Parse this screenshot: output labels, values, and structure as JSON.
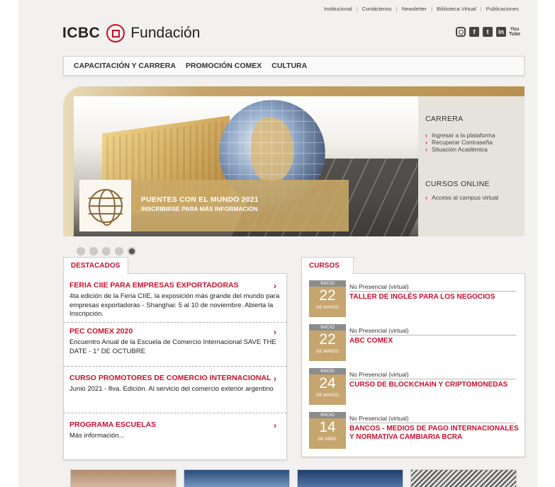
{
  "top_links": [
    "Institucional",
    "Contáctenos",
    "Newsletter",
    "Biblioteca Virtual",
    "Publicaciones"
  ],
  "logo": {
    "brand": "ICBC",
    "name": "Fundación"
  },
  "social": [
    {
      "icon": "instagram-icon",
      "glyph": ""
    },
    {
      "icon": "facebook-icon",
      "glyph": "f"
    },
    {
      "icon": "twitter-icon",
      "glyph": "t"
    },
    {
      "icon": "linkedin-icon",
      "glyph": "in"
    },
    {
      "icon": "youtube-icon",
      "glyph": "You Tube"
    }
  ],
  "nav": [
    "CAPACITACIÓN Y CARRERA",
    "PROMOCIÓN COMEX",
    "CULTURA"
  ],
  "hero": {
    "title": "PUENTES CON EL MUNDO 2021",
    "subtitle": "INSCRIBIRSE PARA MÁS INFORMACIÓN"
  },
  "side_panel": {
    "carrera_title": "CARRERA",
    "carrera_links": [
      "Ingresar a la plataforma",
      "Recuperar Contraseña",
      "Situación Académica"
    ],
    "online_title": "CURSOS ONLINE",
    "online_links": [
      "Acceso al campus virtual"
    ]
  },
  "slider": {
    "count": 5,
    "active_index": 4
  },
  "destacados": {
    "tab": "DESTACADOS",
    "items": [
      {
        "title": "FERIA CIIE PARA EMPRESAS EXPORTADORAS",
        "desc": "4ta edición de la Feria CIIE, la exposición más grande del mundo para empresas exportadoras - Shanghai: 5 al 10 de noviembre. Abierta la Inscripción."
      },
      {
        "title": "PEC COMEX 2020",
        "desc": "Encuentro Anual de la Escuela de Comercio Internacional SAVE THE DATE - 1° DE OCTUBRE"
      },
      {
        "title": "CURSO PROMOTORES DE COMERCIO INTERNACIONAL",
        "desc": "Junio 2021 - 8va. Edición. Al servicio del comercio exterior argentino"
      },
      {
        "title": "PROGRAMA ESCUELAS",
        "desc": "Más información..."
      }
    ]
  },
  "cursos": {
    "tab": "CURSOS",
    "date_label": "INICIO",
    "items": [
      {
        "day": "22",
        "month": "DE MARZO",
        "mode": "No Presencial (virtual)",
        "title": "TALLER DE INGLÉS PARA LOS NEGOCIOS"
      },
      {
        "day": "22",
        "month": "DE MARZO",
        "mode": "No Presencial (virtual)",
        "title": "ABC COMEX"
      },
      {
        "day": "24",
        "month": "DE MARZO",
        "mode": "No Presencial (virtual)",
        "title": "CURSO DE BLOCKCHAIN Y CRIPTOMONEDAS"
      },
      {
        "day": "14",
        "month": "DE ABRIL",
        "mode": "No Presencial (virtual)",
        "title": "BANCOS - MEDIOS DE PAGO INTERNACIONALES Y NORMATIVA CAMBIARIA BCRA"
      }
    ]
  },
  "colors": {
    "brand_red": "#c8102e",
    "gold": "#c6a56e",
    "panel": "#e6e3dc"
  }
}
